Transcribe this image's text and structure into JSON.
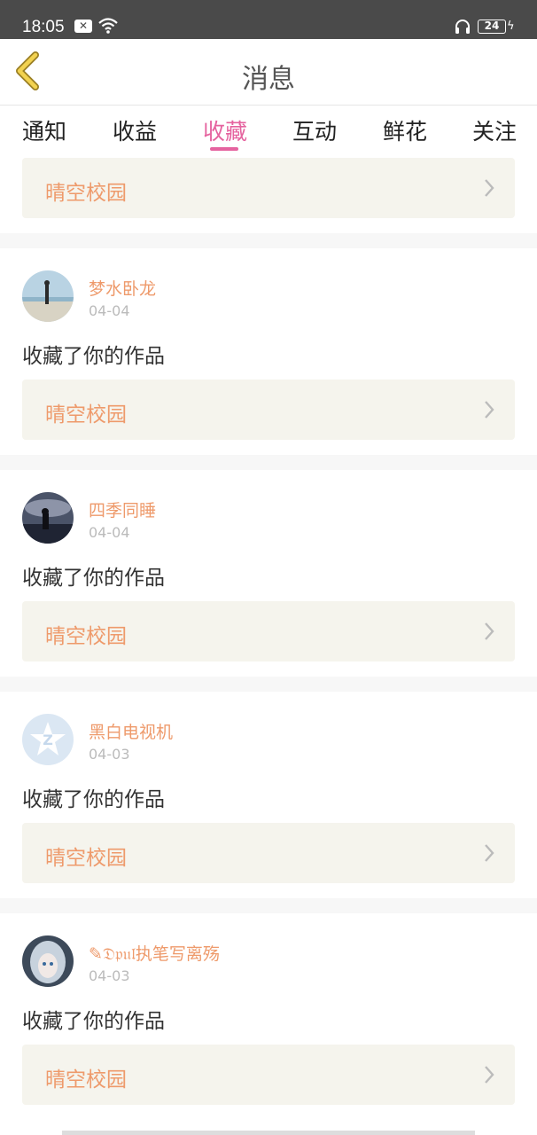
{
  "status_bar": {
    "time": "18:05",
    "battery": "24"
  },
  "header": {
    "title": "消息"
  },
  "tabs": [
    {
      "label": "通知"
    },
    {
      "label": "收益"
    },
    {
      "label": "收藏",
      "active": true
    },
    {
      "label": "互动"
    },
    {
      "label": "鲜花"
    },
    {
      "label": "关注"
    }
  ],
  "top_card": {
    "work_title": "晴空校园"
  },
  "messages": [
    {
      "user": "梦水卧龙",
      "date": "04-04",
      "action": "收藏了你的作品",
      "work_title": "晴空校园"
    },
    {
      "user": "四季同睡",
      "date": "04-04",
      "action": "收藏了你的作品",
      "work_title": "晴空校园"
    },
    {
      "user": "黑白电视机",
      "date": "04-03",
      "action": "收藏了你的作品",
      "work_title": "晴空校园"
    },
    {
      "user": "✎𝔇𝔭𝔲𝔩执笔写离殇",
      "date": "04-03",
      "action": "收藏了你的作品",
      "work_title": "晴空校园"
    }
  ],
  "colors": {
    "accent": "#e5639f",
    "work_title": "#ee9a6b",
    "card_bg": "#f5f4ed",
    "back_arrow": "#e8c84a"
  }
}
